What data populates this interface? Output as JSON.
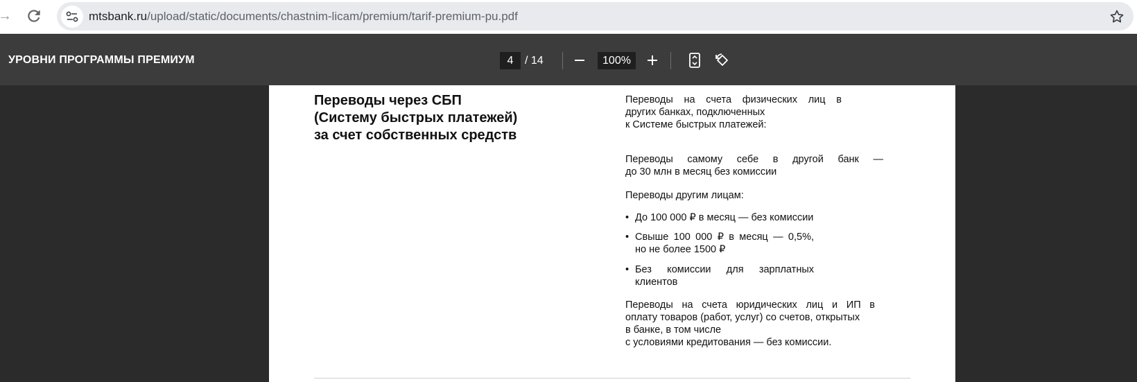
{
  "browser": {
    "url_host": "mtsbank.ru",
    "url_path": "/upload/static/documents/chastnim-licam/premium/tarif-premium-pu.pdf"
  },
  "toolbar": {
    "title": "УРОВНИ ПРОГРАММЫ ПРЕМИУМ",
    "current_page": "4",
    "total_pages": "/ 14",
    "zoom": "100%",
    "zoom_out_label": "−",
    "zoom_in_label": "+"
  },
  "document": {
    "heading_lines": [
      "Переводы через СБП",
      "(Систему быстрых платежей)",
      "за счет собственных средств"
    ],
    "p1_lines": [
      "Переводы на счета физических лиц в",
      "других банках, подключенных",
      "к Системе быстрых платежей:"
    ],
    "p2_lines": [
      "Переводы самому себе в другой банк —",
      "до 30 млн в месяц без комиссии"
    ],
    "p3": "Переводы другим лицам:",
    "bullet1": "До 100 000 ₽ в месяц — без комиссии",
    "bullet2_lines": [
      "Свыше 100 000 ₽ в месяц — 0,5%,",
      "но не более 1500 ₽"
    ],
    "bullet3_lines": [
      "Без комиссии для зарплатных",
      "клиентов"
    ],
    "p5_lines": [
      "Переводы на счета юридических лиц и ИП в",
      "оплату товаров (работ, услуг) со счетов, открытых",
      "в банке, в том числе",
      "с условиями кредитования — без комиссии."
    ]
  },
  "icons": {
    "forward": "arrow-forward-icon",
    "reload": "reload-icon",
    "site_info": "tune-icon",
    "bookmark": "star-icon",
    "fit": "fit-page-icon",
    "rotate": "rotate-icon"
  }
}
